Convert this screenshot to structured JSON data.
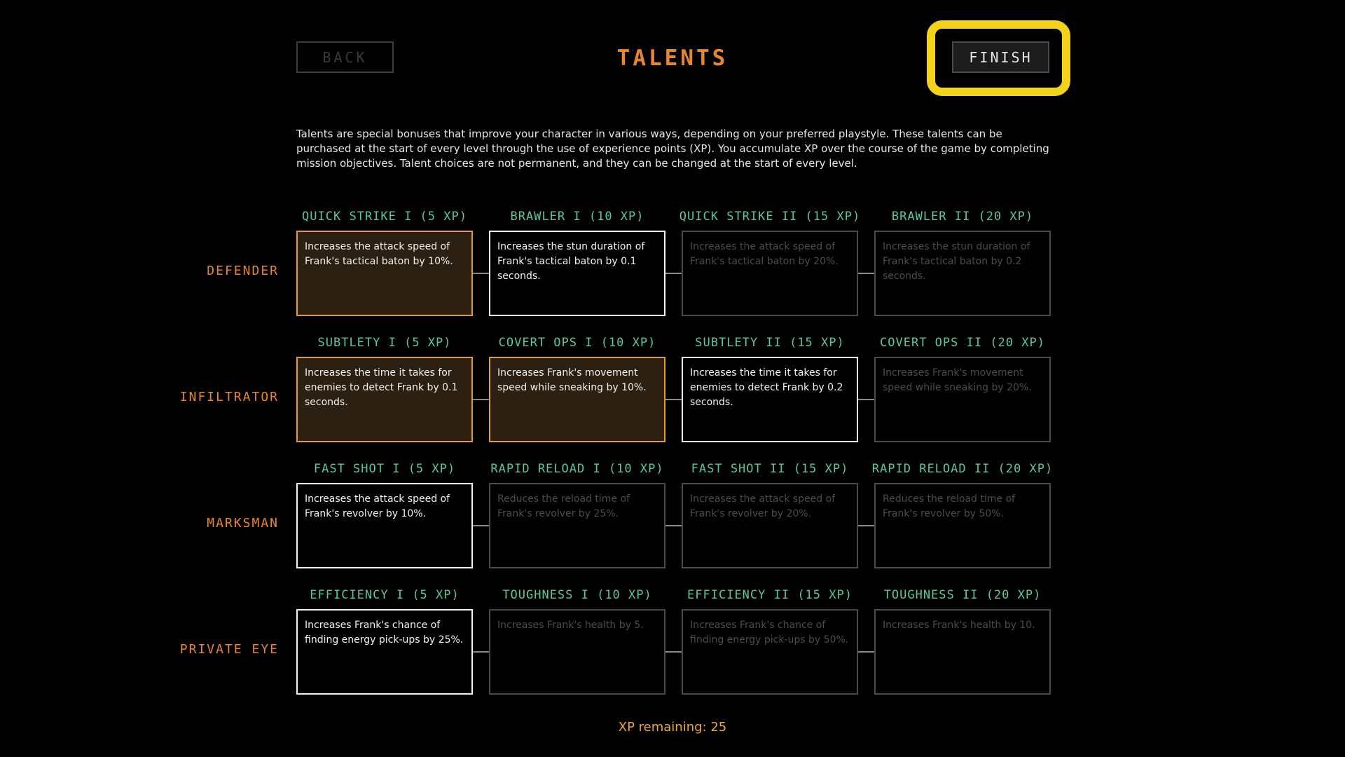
{
  "header": {
    "back_label": "BACK",
    "title": "TALENTS",
    "finish_label": "FINISH"
  },
  "description": "Talents are special bonuses that improve your character in various ways, depending on your preferred playstyle. These talents can be purchased at the start of every level through the use of experience points (XP). You accumulate XP over the course of the game by completing mission objectives. Talent choices are not permanent, and they can be changed at the start of every level.",
  "xp_remaining": "XP remaining: 25",
  "rows": [
    {
      "label": "DEFENDER",
      "talents": [
        {
          "name": "QUICK STRIKE I (5 XP)",
          "desc": "Increases the attack speed of Frank's tactical baton by 10%.",
          "state": "owned"
        },
        {
          "name": "BRAWLER I (10 XP)",
          "desc": "Increases the stun duration of Frank's tactical baton by 0.1 seconds.",
          "state": "available"
        },
        {
          "name": "QUICK STRIKE II (15 XP)",
          "desc": "Increases the attack speed of Frank's tactical baton by 20%.",
          "state": "locked"
        },
        {
          "name": "BRAWLER II (20 XP)",
          "desc": "Increases the stun duration of Frank's tactical baton by 0.2 seconds.",
          "state": "locked"
        }
      ]
    },
    {
      "label": "INFILTRATOR",
      "talents": [
        {
          "name": "SUBTLETY I (5 XP)",
          "desc": "Increases the time it takes for enemies to detect Frank by 0.1 seconds.",
          "state": "owned"
        },
        {
          "name": "COVERT OPS I (10 XP)",
          "desc": "Increases Frank's movement speed while sneaking by 10%.",
          "state": "owned"
        },
        {
          "name": "SUBTLETY II (15 XP)",
          "desc": "Increases the time it takes for enemies to detect Frank by 0.2 seconds.",
          "state": "available"
        },
        {
          "name": "COVERT OPS II (20 XP)",
          "desc": "Increases Frank's movement speed while sneaking by 20%.",
          "state": "locked"
        }
      ]
    },
    {
      "label": "MARKSMAN",
      "talents": [
        {
          "name": "FAST SHOT I (5 XP)",
          "desc": "Increases the attack speed of Frank's revolver by 10%.",
          "state": "available"
        },
        {
          "name": "RAPID RELOAD I (10 XP)",
          "desc": "Reduces the reload time of Frank's revolver by 25%.",
          "state": "locked"
        },
        {
          "name": "FAST SHOT II (15 XP)",
          "desc": "Increases the attack speed of Frank's revolver by 20%.",
          "state": "locked"
        },
        {
          "name": "RAPID RELOAD II (20 XP)",
          "desc": "Reduces the reload time of Frank's revolver by 50%.",
          "state": "locked"
        }
      ]
    },
    {
      "label": "PRIVATE EYE",
      "talents": [
        {
          "name": "EFFICIENCY I (5 XP)",
          "desc": "Increases Frank's chance of finding energy pick-ups by 25%.",
          "state": "available"
        },
        {
          "name": "TOUGHNESS I (10 XP)",
          "desc": "Increases Frank's health by 5.",
          "state": "locked"
        },
        {
          "name": "EFFICIENCY II (15 XP)",
          "desc": "Increases Frank's chance of finding energy pick-ups by 50%.",
          "state": "locked"
        },
        {
          "name": "TOUGHNESS II (20 XP)",
          "desc": "Increases Frank's health by 10.",
          "state": "locked"
        }
      ]
    }
  ]
}
